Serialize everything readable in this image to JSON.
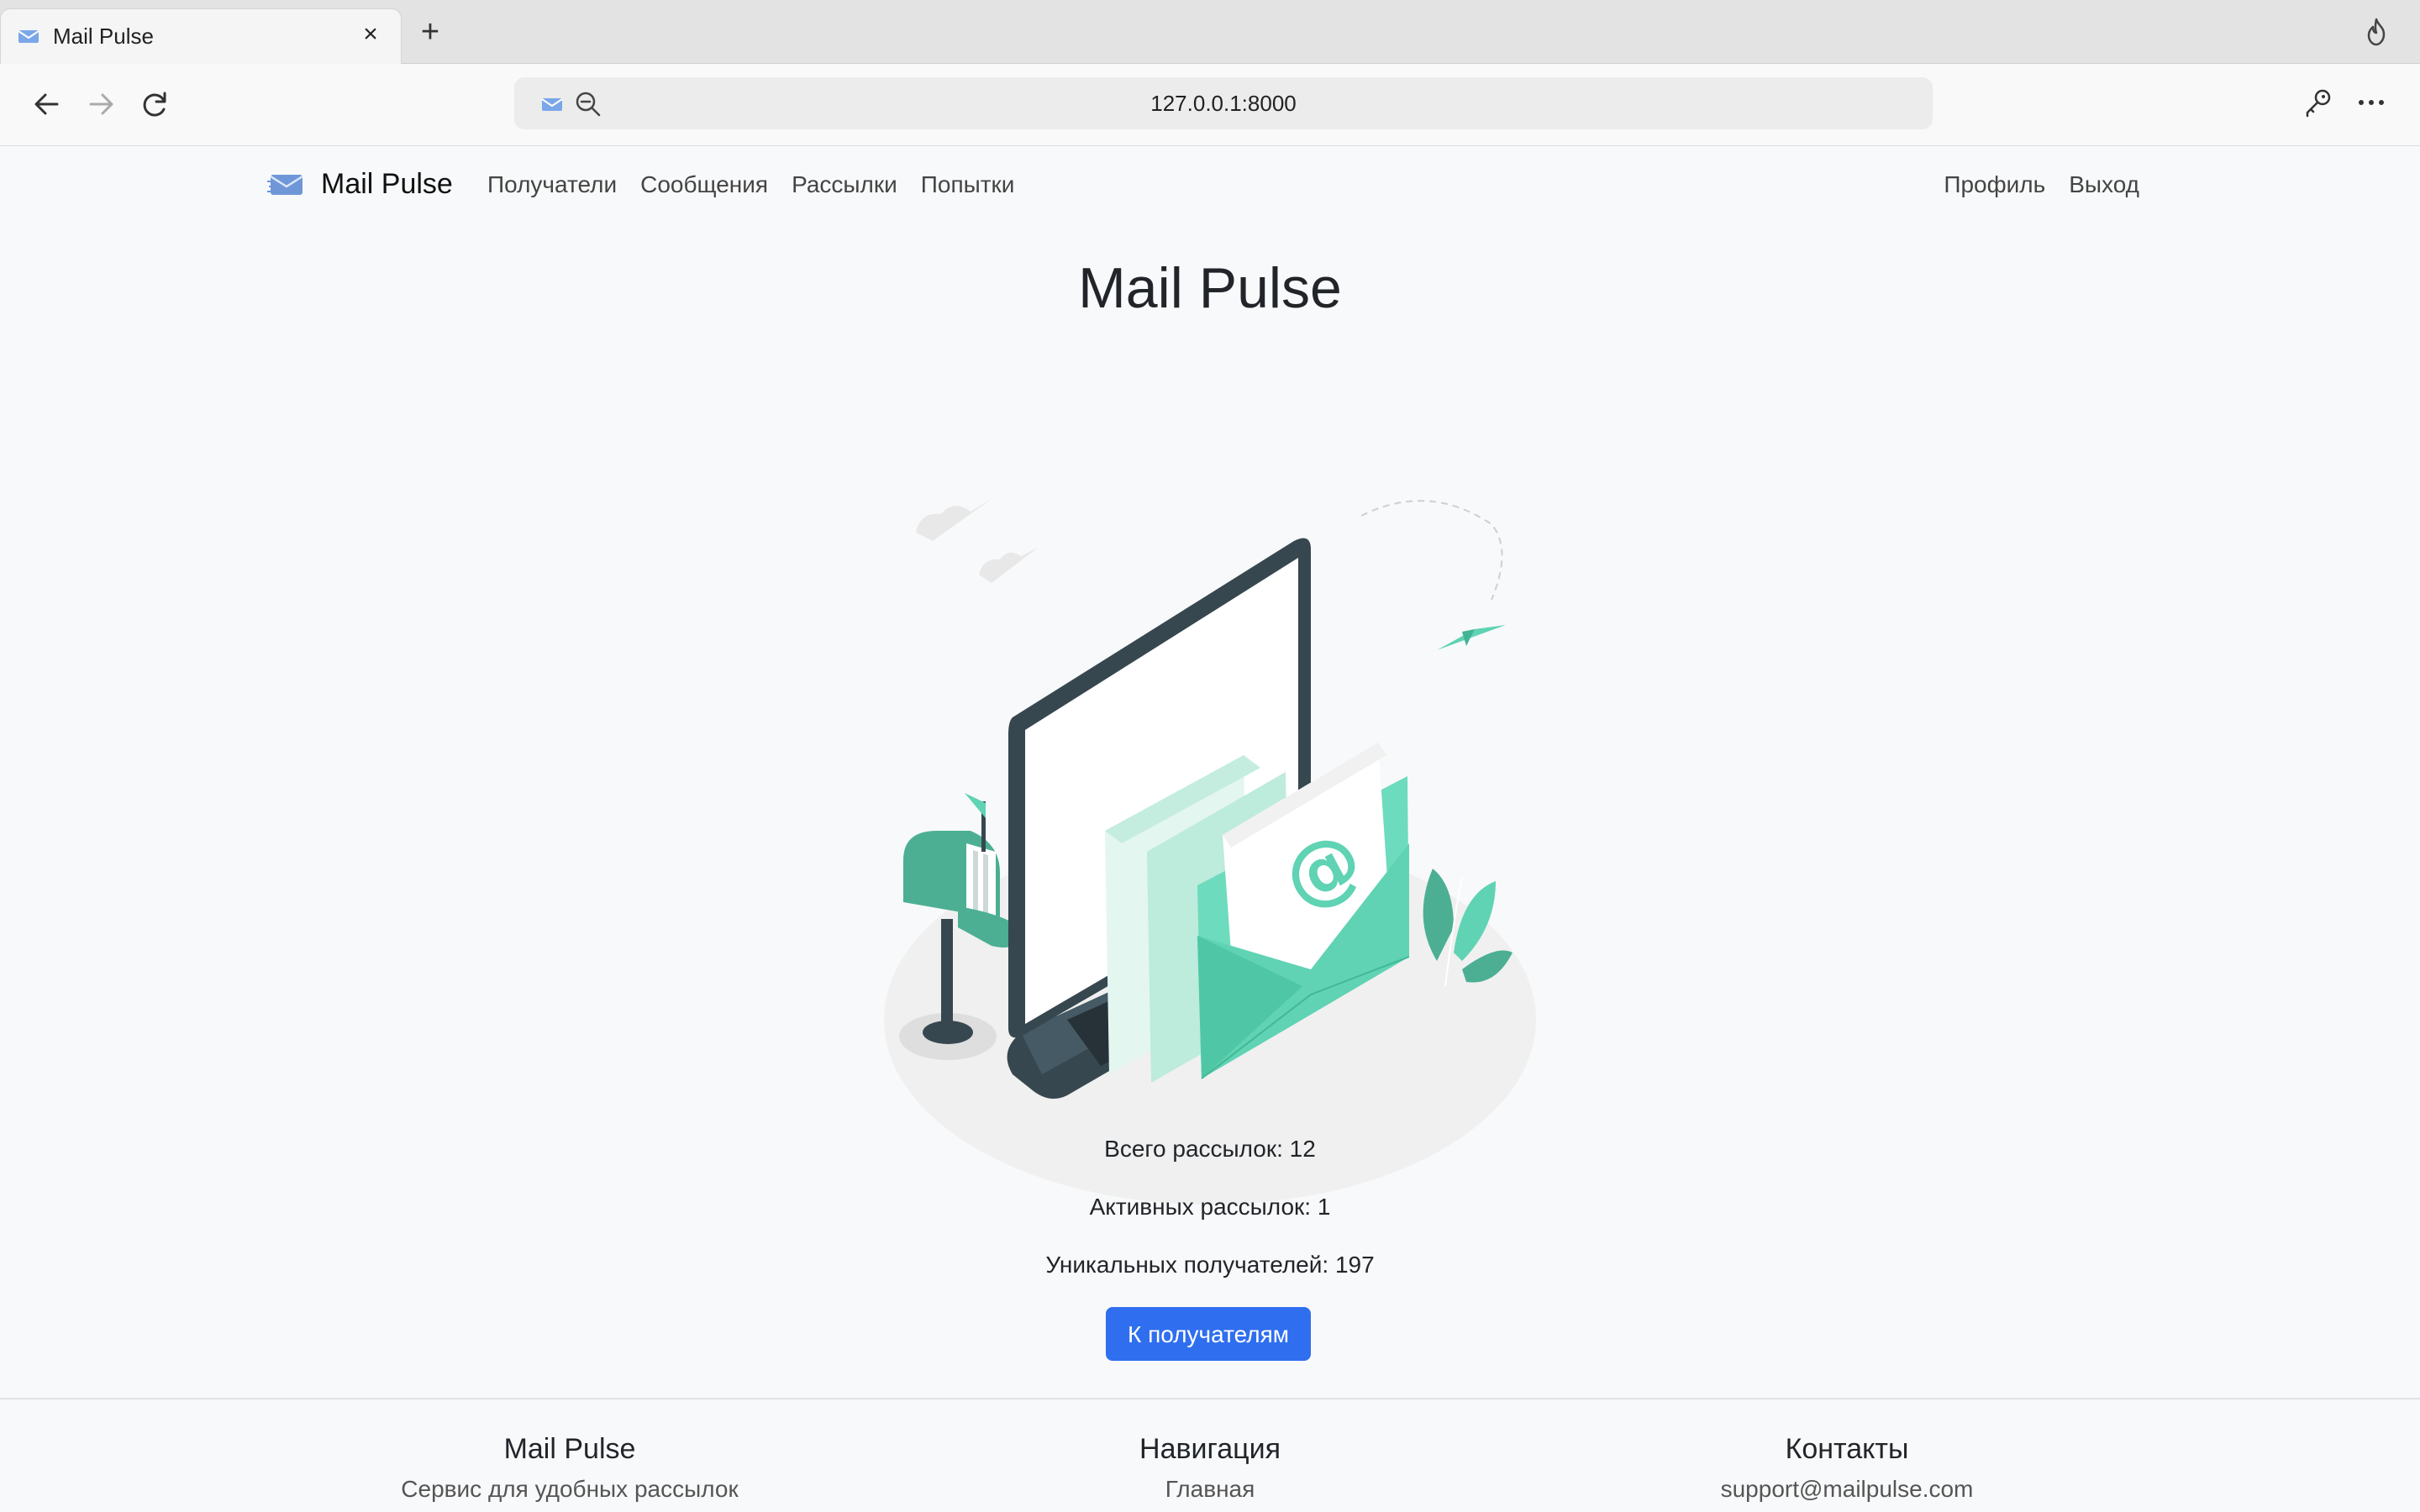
{
  "browser": {
    "tab_title": "Mail Pulse",
    "url": "127.0.0.1:8000"
  },
  "navbar": {
    "brand": "Mail Pulse",
    "links": [
      "Получатели",
      "Сообщения",
      "Рассылки",
      "Попытки"
    ],
    "right_links": [
      "Профиль",
      "Выход"
    ]
  },
  "hero": {
    "title": "Mail Pulse"
  },
  "stats": {
    "total_label": "Всего рассылок: 12",
    "active_label": "Активных рассылок: 1",
    "recipients_label": "Уникальных получателей: 197"
  },
  "cta": {
    "label": "К получателям"
  },
  "footer": {
    "col1_title": "Mail Pulse",
    "col1_text": "Сервис для удобных рассылок",
    "col2_title": "Навигация",
    "col2_text": "Главная",
    "col3_title": "Контакты",
    "col3_text": "support@mailpulse.com"
  },
  "colors": {
    "accent": "#2f6fef",
    "illustration_green": "#5fd3b3",
    "illustration_dark": "#37474f"
  }
}
